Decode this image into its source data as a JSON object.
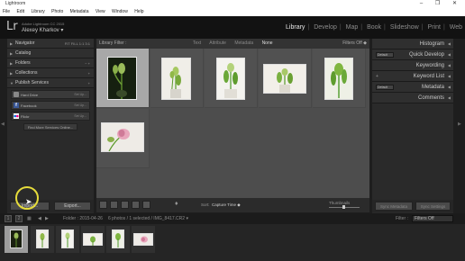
{
  "window": {
    "title": "Lightroom",
    "controls": "–  ❐  ✕"
  },
  "menu": [
    "File",
    "Edit",
    "Library",
    "Photo",
    "Metadata",
    "View",
    "Window",
    "Help"
  ],
  "identity": {
    "logo": "Lr",
    "product": "Adobe Lightroom CC 2015",
    "user": "Alexey Kharkov ▾"
  },
  "modules": {
    "items": [
      "Library",
      "Develop",
      "Map",
      "Book",
      "Slideshow",
      "Print",
      "Web"
    ],
    "active": "Library"
  },
  "left_panel": {
    "navigator": {
      "label": "Navigator",
      "options": "FIT  FILL  1:1  3:1"
    },
    "catalog": {
      "label": "Catalog"
    },
    "folders": {
      "label": "Folders",
      "controls": "−  +"
    },
    "collections": {
      "label": "Collections",
      "controls": "+"
    },
    "publish": {
      "label": "Publish Services",
      "controls": "+"
    },
    "services": [
      {
        "name": "Hard Drive",
        "action": "Set Up..."
      },
      {
        "name": "Facebook",
        "action": "Set Up..."
      },
      {
        "name": "Flickr",
        "action": "Set Up..."
      }
    ],
    "find_more": "Find More Services Online...",
    "import": "Import...",
    "export": "Export..."
  },
  "filter_bar": {
    "label": "Library Filter :",
    "items": [
      "Text",
      "Attribute",
      "Metadata",
      "None"
    ],
    "selected": "None",
    "filters": "Filters Off ◆"
  },
  "toolbar": {
    "sort_label": "Sort:",
    "sort_value": "Capture Time ◆",
    "thumbs_label": "Thumbnails"
  },
  "grid": {
    "selected_index": 0,
    "photos": [
      {
        "tone": "dark"
      },
      {
        "tone": "light"
      },
      {
        "tone": "light"
      },
      {
        "tone": "light"
      },
      {
        "tone": "light"
      },
      {
        "tone": "light"
      }
    ]
  },
  "right_panel": {
    "histogram": "Histogram",
    "quick_develop": {
      "label": "Quick Develop",
      "preset": "Default"
    },
    "keywording": "Keywording",
    "keyword_list": "Keyword List",
    "metadata": {
      "label": "Metadata",
      "preset": "Default"
    },
    "comments": "Comments",
    "sync_metadata": "Sync Metadata",
    "sync_settings": "Sync Settings"
  },
  "filmstrip_nav": {
    "page1": "1",
    "page2": "2",
    "folder": "Folder : 2015-04-26",
    "count": "6 photos / 1 selected / IMG_8417.CR2 ▾",
    "filter_label": "Filter :",
    "filter_value": "Filters Off"
  },
  "colors": {
    "accent": "#e8e8e8",
    "cursor_ring": "#e6dc3b",
    "facebook": "#3b5998",
    "flickr_pink": "#ff0084",
    "flickr_blue": "#0063dc"
  }
}
